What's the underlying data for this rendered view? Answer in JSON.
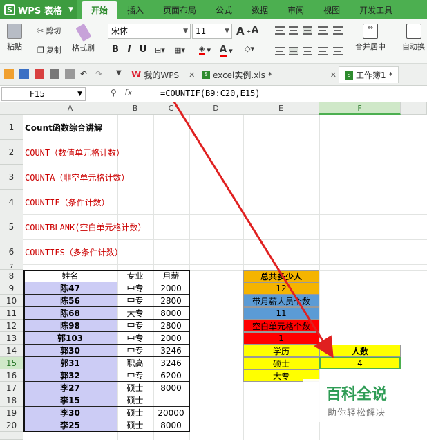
{
  "app": {
    "title": "WPS 表格"
  },
  "menu_tabs": [
    "开始",
    "插入",
    "页面布局",
    "公式",
    "数据",
    "审阅",
    "视图",
    "开发工具"
  ],
  "ribbon": {
    "paste": "粘贴",
    "cut": "剪切",
    "copy": "复制",
    "format_painter": "格式刷",
    "font_name": "宋体",
    "font_size": "11",
    "bold": "B",
    "italic": "I",
    "underline": "U",
    "merge_center": "合并居中",
    "wrap": "自动换"
  },
  "doc_tabs": [
    {
      "label": "我的WPS"
    },
    {
      "label": "excel实例.xls *"
    },
    {
      "label": "工作簿1 *"
    }
  ],
  "formula_bar": {
    "cell_ref": "F15",
    "fx": "fx",
    "formula": "=COUNTIF(B9:C20,E15)"
  },
  "columns": [
    "A",
    "B",
    "C",
    "D",
    "E",
    "F"
  ],
  "rows": [
    "1",
    "2",
    "3",
    "4",
    "5",
    "6",
    "7",
    "8",
    "9",
    "10",
    "11",
    "12",
    "13",
    "14",
    "15",
    "16",
    "17",
    "18",
    "19",
    "20"
  ],
  "intro": {
    "title": "Count函数综合讲解",
    "lines": [
      "COUNT（数值单元格计数）",
      "COUNTA（非空单元格计数）",
      "COUNTIF（条件计数）",
      "COUNTBLANK(空白单元格计数）",
      "COUNTIFS（多条件计数）"
    ]
  },
  "table": {
    "headers": [
      "姓名",
      "专业",
      "月薪"
    ],
    "rows": [
      [
        "陈47",
        "中专",
        "2000"
      ],
      [
        "陈56",
        "中专",
        "2800"
      ],
      [
        "陈68",
        "大专",
        "8000"
      ],
      [
        "陈98",
        "中专",
        "2800"
      ],
      [
        "郭103",
        "中专",
        "2000"
      ],
      [
        "郭30",
        "中专",
        "3246"
      ],
      [
        "郭31",
        "职高",
        "3246"
      ],
      [
        "郭32",
        "中专",
        "6200"
      ],
      [
        "李27",
        "硕士",
        "8000"
      ],
      [
        "李15",
        "硕士",
        ""
      ],
      [
        "李30",
        "硕士",
        "20000"
      ],
      [
        "李25",
        "硕士",
        "8000"
      ]
    ]
  },
  "summary": {
    "total_label": "总共多少人",
    "total_value": "12",
    "salary_label": "带月薪人员个数",
    "salary_value": "11",
    "blank_label": "空白单元格个数",
    "blank_value": "1",
    "edu_label": "学历",
    "count_label": "人数",
    "edu1": "硕士",
    "count1": "4",
    "edu2": "大专"
  },
  "watermark": {
    "line1": "百科全说",
    "line2": "助你轻松解决"
  },
  "colors": {
    "accent": "#4caf50",
    "orange": "#f5b400",
    "blue": "#5b9bd5",
    "red": "#ff0000",
    "yellow": "#ffff00",
    "lavender": "#ccccf5",
    "arrow": "#e02020"
  }
}
